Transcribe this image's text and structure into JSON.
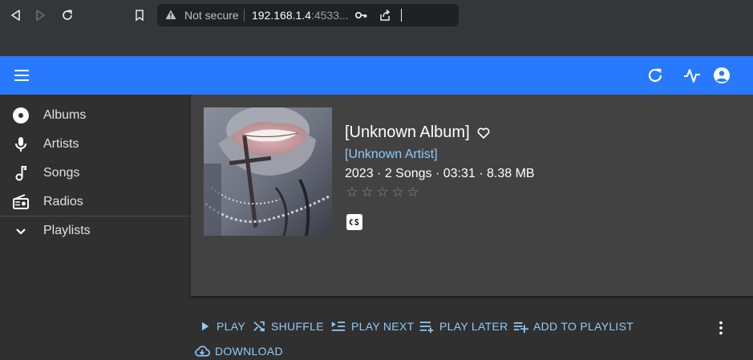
{
  "browser": {
    "security_label": "Not secure",
    "url_host": "192.168.1.4",
    "url_rest": ":4533..."
  },
  "sidebar": {
    "items": [
      {
        "label": "Albums",
        "icon": "album-icon"
      },
      {
        "label": "Artists",
        "icon": "microphone-icon"
      },
      {
        "label": "Songs",
        "icon": "music-note-icon"
      },
      {
        "label": "Radios",
        "icon": "radio-icon"
      },
      {
        "label": "Playlists",
        "icon": "chevron-down-icon"
      }
    ]
  },
  "album": {
    "title": "[Unknown Album]",
    "artist": "[Unknown Artist]",
    "meta": "2023 · 2 Songs · 03:31 · 8.38 MB",
    "rating": 0,
    "max_rating": 5
  },
  "actions": {
    "play": "PLAY",
    "shuffle": "SHUFFLE",
    "play_next": "PLAY NEXT",
    "play_later": "PLAY LATER",
    "add_to_playlist": "ADD TO PLAYLIST",
    "download": "DOWNLOAD"
  },
  "colors": {
    "app_bar": "#2979ff",
    "accent_text": "#90caf9",
    "card": "#424242",
    "background": "#303030"
  }
}
